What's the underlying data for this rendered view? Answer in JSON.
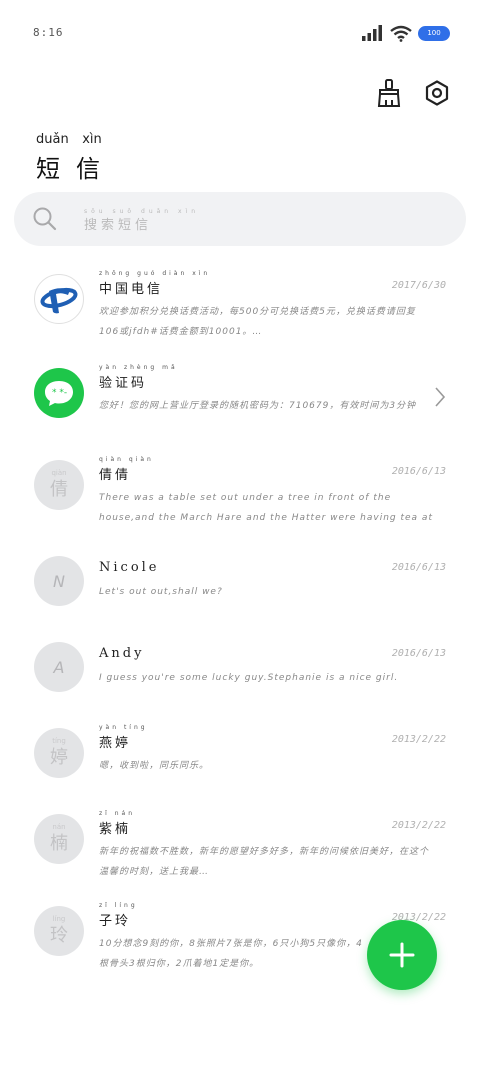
{
  "status": {
    "time": "8:16",
    "battery": "100"
  },
  "header": {
    "title_pinyin": [
      "duǎn",
      "xìn"
    ],
    "title": "短信",
    "clean_icon": "broom-icon",
    "settings_icon": "hex-settings-icon"
  },
  "search": {
    "placeholder_pinyin": "sōu suǒ duǎn xìn",
    "placeholder": "搜索短信"
  },
  "messages": [
    {
      "name_pinyin": "zhōng guó diàn xìn",
      "name": "中国电信",
      "date": "2017/6/30",
      "preview": "欢迎参加积分兑换话费活动，每500分可兑换话费5元，兑换话费请回复106或jfdh#话费金额到10001。…",
      "avatar": "china-telecom-logo"
    },
    {
      "name_pinyin": "yàn zhèng mǎ",
      "name": "验证码",
      "date": "",
      "preview": "您好！您的网上营业厅登录的随机密码为：710679，有效时间为3分钟",
      "avatar": "chat-bubble-icon"
    },
    {
      "name_pinyin": "qiàn qiàn",
      "name": "倩倩",
      "date": "2016/6/13",
      "preview": "There was a table set out under a tree in front of the house,and the March Hare and the Hatter were having tea at it.",
      "avatar_pinyin": "qiàn",
      "avatar_char": "倩"
    },
    {
      "name_pinyin": "",
      "name": "Nicole",
      "date": "2016/6/13",
      "preview": "Let's out out,shall we?",
      "avatar_letter": "N"
    },
    {
      "name_pinyin": "",
      "name": "Andy",
      "date": "2016/6/13",
      "preview": "I guess you're some lucky guy.Stephanie is a nice girl.",
      "avatar_letter": "A"
    },
    {
      "name_pinyin": "yàn tíng",
      "name": "燕婷",
      "date": "2013/2/22",
      "preview": "嗯，收到啦，同乐同乐。",
      "avatar_pinyin": "tíng",
      "avatar_char": "婷"
    },
    {
      "name_pinyin": "zǐ nán",
      "name": "紫楠",
      "date": "2013/2/22",
      "preview": "新年的祝福数不胜数，新年的愿望好多好多，新年的问候依旧美好，在这个温馨的时刻，送上我最…",
      "avatar_pinyin": "nán",
      "avatar_char": "楠"
    },
    {
      "name_pinyin": "zǐ líng",
      "name": "子玲",
      "date": "2013/2/22",
      "preview": "10分想念9刻的你，8张照片7张是你，6只小狗5只像你，4根骨头3根归你，2爪着地1定是你。",
      "avatar_pinyin": "líng",
      "avatar_char": "玲"
    }
  ],
  "fab": {
    "icon": "plus-icon"
  }
}
